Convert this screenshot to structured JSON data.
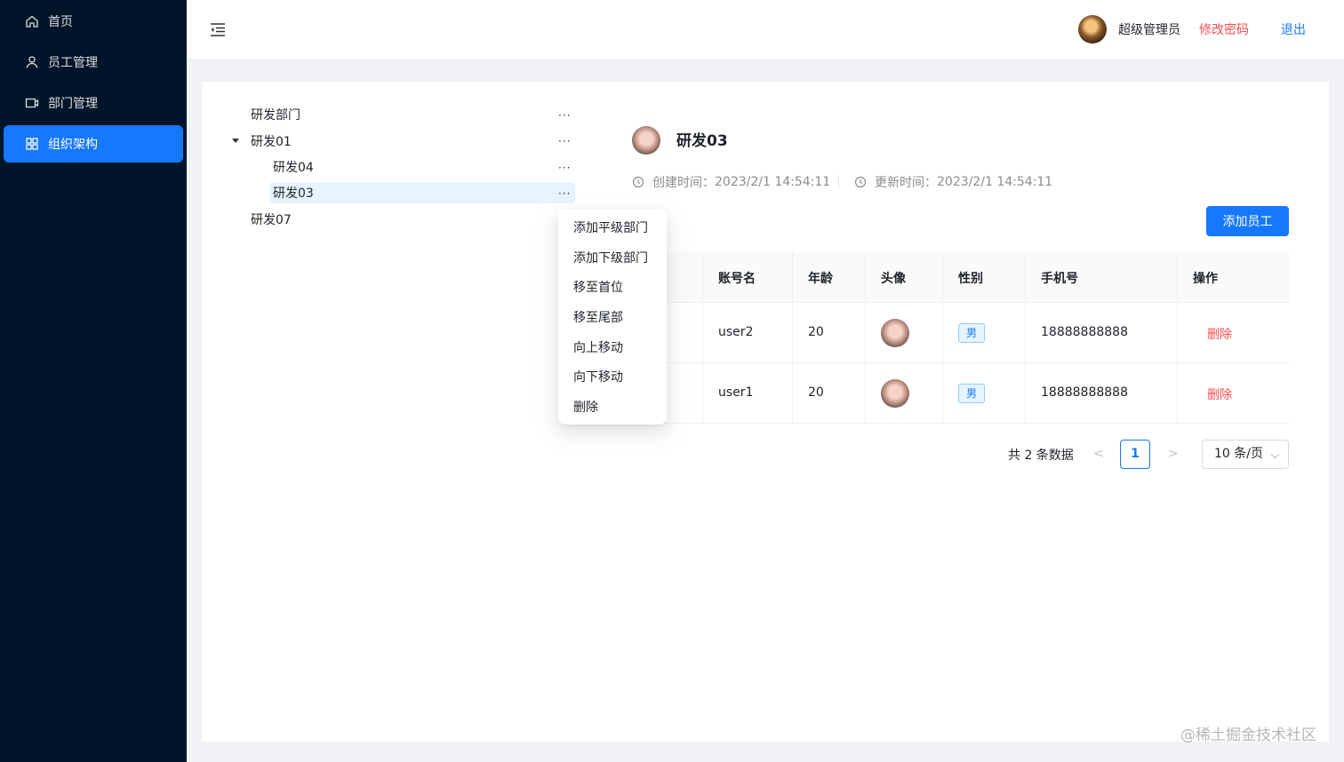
{
  "sidebar": {
    "items": [
      {
        "label": "首页",
        "icon": "home-icon"
      },
      {
        "label": "员工管理",
        "icon": "user-icon"
      },
      {
        "label": "部门管理",
        "icon": "department-icon"
      },
      {
        "label": "组织架构",
        "icon": "org-icon",
        "active": true
      }
    ]
  },
  "header": {
    "user_name": "超级管理员",
    "change_password": "修改密码",
    "logout": "退出"
  },
  "tree": {
    "nodes": [
      {
        "label": "研发部门",
        "level": 0
      },
      {
        "label": "研发01",
        "level": 0,
        "expanded": true
      },
      {
        "label": "研发04",
        "level": 1
      },
      {
        "label": "研发03",
        "level": 1,
        "selected": true
      },
      {
        "label": "研发07",
        "level": 0
      }
    ],
    "more": "···"
  },
  "dropdown": {
    "items": [
      "添加平级部门",
      "添加下级部门",
      "移至首位",
      "移至尾部",
      "向上移动",
      "向下移动",
      "删除"
    ]
  },
  "detail": {
    "title": "研发03",
    "created_label": "创建时间：",
    "created_value": "2023/2/1 14:54:11",
    "updated_label": "更新时间：",
    "updated_value": "2023/2/1 14:54:11",
    "add_button": "添加员工"
  },
  "table": {
    "headers": [
      "账号名",
      "年龄",
      "头像",
      "性别",
      "手机号",
      "操作"
    ],
    "rows": [
      {
        "account": "user2",
        "age": "20",
        "gender": "男",
        "phone": "18888888888",
        "action": "删除"
      },
      {
        "account": "user1",
        "age": "20",
        "gender": "男",
        "phone": "18888888888",
        "action": "删除"
      }
    ]
  },
  "pagination": {
    "total": "共 2 条数据",
    "prev": "<",
    "next": ">",
    "current": "1",
    "page_size": "10 条/页"
  },
  "watermark": "@稀土掘金技术社区",
  "colors": {
    "primary": "#1677ff",
    "danger": "#ff4d4f",
    "sidebar": "#001529"
  }
}
